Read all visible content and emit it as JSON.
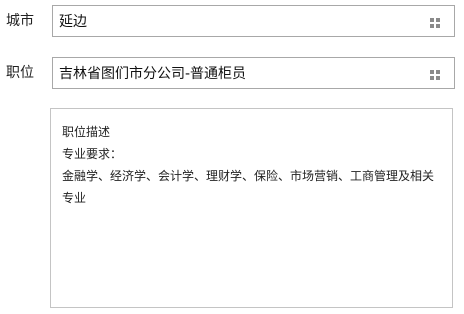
{
  "city": {
    "label": "城市",
    "value": "延边"
  },
  "position": {
    "label": "职位",
    "value": "吉林省图们市分公司-普通柜员"
  },
  "description": {
    "lines": [
      "职位描述",
      "专业要求：",
      "金融学、经济学、会计学、理财学、保险、市场营销、工商管理及相关",
      "专业"
    ]
  },
  "icons": {
    "field_menu": "grid-menu-icon"
  },
  "colors": {
    "border": "#a8a8a8",
    "icon": "#8a8a8a"
  }
}
